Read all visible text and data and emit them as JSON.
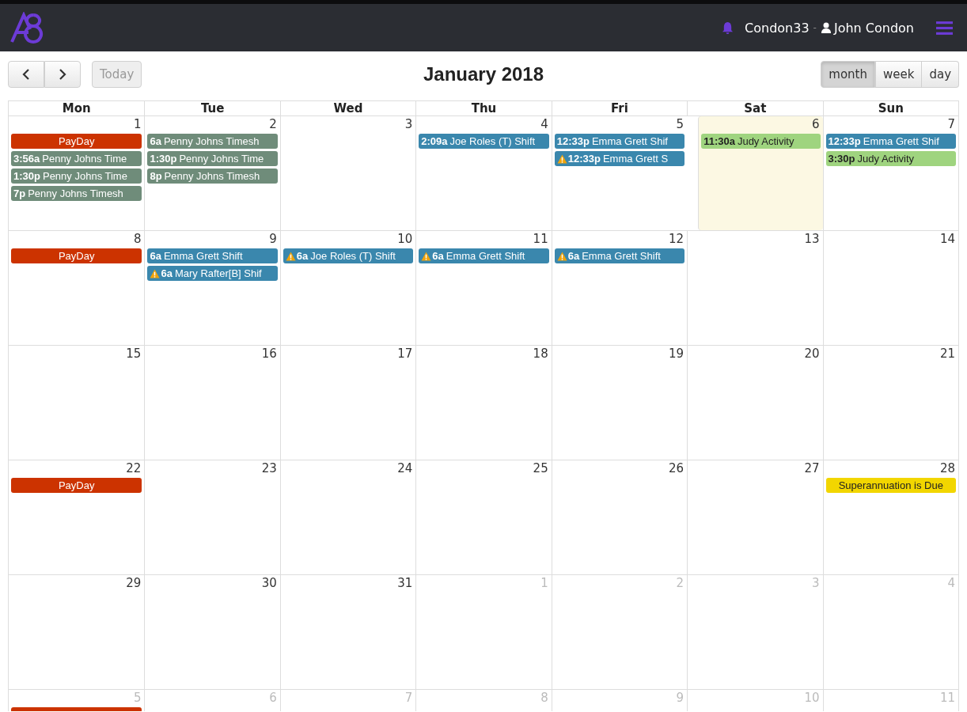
{
  "header": {
    "user_code": "Condon33",
    "separator": "-",
    "user_name": "John Condon"
  },
  "toolbar": {
    "title": "January 2018",
    "today_button": {
      "label": "Today",
      "disabled": true
    },
    "views": [
      {
        "label": "month",
        "selected": true
      },
      {
        "label": "week",
        "selected": false
      },
      {
        "label": "day",
        "selected": false
      }
    ]
  },
  "calendar": {
    "weekdays": [
      "Mon",
      "Tue",
      "Wed",
      "Thu",
      "Fri",
      "Sat",
      "Sun"
    ],
    "weeks": [
      [
        {
          "date": "1",
          "other": false,
          "events": [
            {
              "title": "PayDay",
              "color": "#cc3300",
              "warning": false
            },
            {
              "time": "3:56a",
              "title": "Penny Johns Time",
              "color": "#6f8c7a",
              "warning": false
            },
            {
              "time": "1:30p",
              "title": "Penny Johns Time",
              "color": "#6f8c7a",
              "warning": false
            },
            {
              "time": "7p",
              "title": "Penny Johns Timesh",
              "color": "#6f8c7a",
              "warning": false
            }
          ]
        },
        {
          "date": "2",
          "other": false,
          "events": [
            {
              "time": "6a",
              "title": "Penny Johns Timesh",
              "color": "#6f8c7a",
              "warning": false
            },
            {
              "time": "1:30p",
              "title": "Penny Johns Time",
              "color": "#6f8c7a",
              "warning": false
            },
            {
              "time": "8p",
              "title": "Penny Johns Timesh",
              "color": "#6f8c7a",
              "warning": false
            }
          ]
        },
        {
          "date": "3",
          "other": false
        },
        {
          "date": "4",
          "other": false,
          "events": [
            {
              "time": "2:09a",
              "title": "Joe Roles (T) Shift",
              "color": "#3a87ad",
              "warning": false
            }
          ]
        },
        {
          "date": "5",
          "other": false,
          "events": [
            {
              "time": "12:33p",
              "title": "Emma Grett Shif",
              "color": "#3a87ad",
              "warning": false
            },
            {
              "time": "12:33p",
              "title": "Emma Grett S",
              "color": "#3a87ad",
              "warning": true
            }
          ]
        },
        {
          "date": "6",
          "other": false,
          "today": true,
          "events": [
            {
              "time": "11:30a",
              "title": "Judy Activity",
              "color": "#9fd47f",
              "warning": false
            }
          ]
        },
        {
          "date": "7",
          "other": false,
          "events": [
            {
              "time": "12:33p",
              "title": "Emma Grett Shif",
              "color": "#3a87ad",
              "warning": false
            },
            {
              "time": "3:30p",
              "title": "Judy Activity",
              "color": "#9fd47f",
              "warning": false
            }
          ]
        }
      ],
      [
        {
          "date": "8",
          "other": false,
          "events": [
            {
              "title": "PayDay",
              "color": "#cc3300",
              "warning": false
            }
          ]
        },
        {
          "date": "9",
          "other": false,
          "events": [
            {
              "time": "6a",
              "title": "Emma Grett Shift",
              "color": "#3a87ad",
              "warning": false
            },
            {
              "time": "6a",
              "title": "Mary Rafter[B] Shif",
              "color": "#3a87ad",
              "warning": true
            }
          ]
        },
        {
          "date": "10",
          "other": false,
          "events": [
            {
              "time": "6a",
              "title": "Joe Roles (T) Shift",
              "color": "#3a87ad",
              "warning": true
            }
          ]
        },
        {
          "date": "11",
          "other": false,
          "events": [
            {
              "time": "6a",
              "title": "Emma Grett Shift",
              "color": "#3a87ad",
              "warning": true
            }
          ]
        },
        {
          "date": "12",
          "other": false,
          "events": [
            {
              "time": "6a",
              "title": "Emma Grett Shift",
              "color": "#3a87ad",
              "warning": true
            }
          ]
        },
        {
          "date": "13",
          "other": false
        },
        {
          "date": "14",
          "other": false
        }
      ],
      [
        {
          "date": "15",
          "other": false
        },
        {
          "date": "16",
          "other": false
        },
        {
          "date": "17",
          "other": false
        },
        {
          "date": "18",
          "other": false
        },
        {
          "date": "19",
          "other": false
        },
        {
          "date": "20",
          "other": false
        },
        {
          "date": "21",
          "other": false
        }
      ],
      [
        {
          "date": "22",
          "other": false,
          "events": [
            {
              "title": "PayDay",
              "color": "#cc3300",
              "warning": false
            }
          ]
        },
        {
          "date": "23",
          "other": false
        },
        {
          "date": "24",
          "other": false
        },
        {
          "date": "25",
          "other": false
        },
        {
          "date": "26",
          "other": false
        },
        {
          "date": "27",
          "other": false
        },
        {
          "date": "28",
          "other": false,
          "events": [
            {
              "title": "Superannuation is Due",
              "color": "#f2d600",
              "warning": false
            }
          ]
        }
      ],
      [
        {
          "date": "29",
          "other": false
        },
        {
          "date": "30",
          "other": false
        },
        {
          "date": "31",
          "other": false
        },
        {
          "date": "1",
          "other": true
        },
        {
          "date": "2",
          "other": true
        },
        {
          "date": "3",
          "other": true
        },
        {
          "date": "4",
          "other": true
        }
      ],
      [
        {
          "date": "5",
          "other": true,
          "events": [
            {
              "color": "#cc3300"
            }
          ]
        },
        {
          "date": "6",
          "other": true
        },
        {
          "date": "7",
          "other": true
        },
        {
          "date": "8",
          "other": true
        },
        {
          "date": "9",
          "other": true
        },
        {
          "date": "10",
          "other": true
        },
        {
          "date": "11",
          "other": true
        }
      ]
    ]
  }
}
